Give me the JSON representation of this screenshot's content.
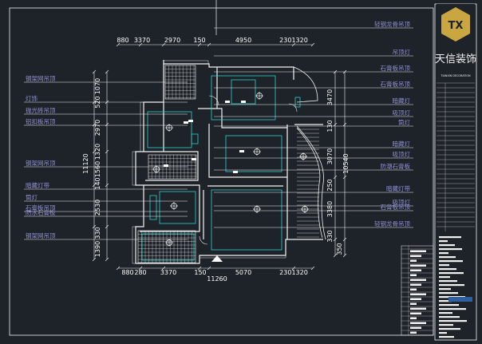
{
  "colors": {
    "background": "#1e2329",
    "frame": "#f2f2f2",
    "walls": "#f2f2f2",
    "annotation": "#8f8fd0",
    "dimension": "#ffffff",
    "leader": "#f2f2f2",
    "furniture": "#2fd0d0",
    "lights": "#ffffff",
    "grid": "#f2f2f2",
    "logo_gold": "#c9a640",
    "sheet_blue": "#2f5fa0"
  },
  "title_block": {
    "logo_text": "TX",
    "company_name": "天信装饰",
    "company_subtitle": "TIANXIN DECORATION"
  },
  "dimensions": {
    "top": [
      "880",
      "3370",
      "2970",
      "150",
      "4950",
      "2301320"
    ],
    "bottom": [
      "880",
      "280",
      "3370",
      "150",
      "5070",
      "2301320"
    ],
    "bottom_total": "11260",
    "left": [
      "1070",
      "520",
      "2970",
      "1320",
      "11120",
      "1560",
      "140",
      "2530",
      "330",
      "1390"
    ],
    "right": [
      "3470",
      "130",
      "3070",
      "10540",
      "250",
      "3380",
      "330",
      "350"
    ]
  },
  "left_notes": [
    "钢架网吊顶",
    "灯饰",
    "抛光砖吊顶",
    "铝扣板吊顶",
    "钢架网吊顶",
    "暗藏灯带",
    "筒灯",
    "石膏板吊顶",
    "防水石膏板",
    "钢架网吊顶"
  ],
  "right_notes": [
    "轻钢龙骨吊顶",
    "吊顶灯",
    "石膏板吊顶",
    "石膏板吊顶",
    "暗藏灯",
    "吸顶灯",
    "筒灯",
    "暗藏灯",
    "吸顶灯",
    "防潮石膏板",
    "暗藏灯带",
    "吸顶灯",
    "石膏板吊顶",
    "轻钢龙骨吊顶"
  ]
}
